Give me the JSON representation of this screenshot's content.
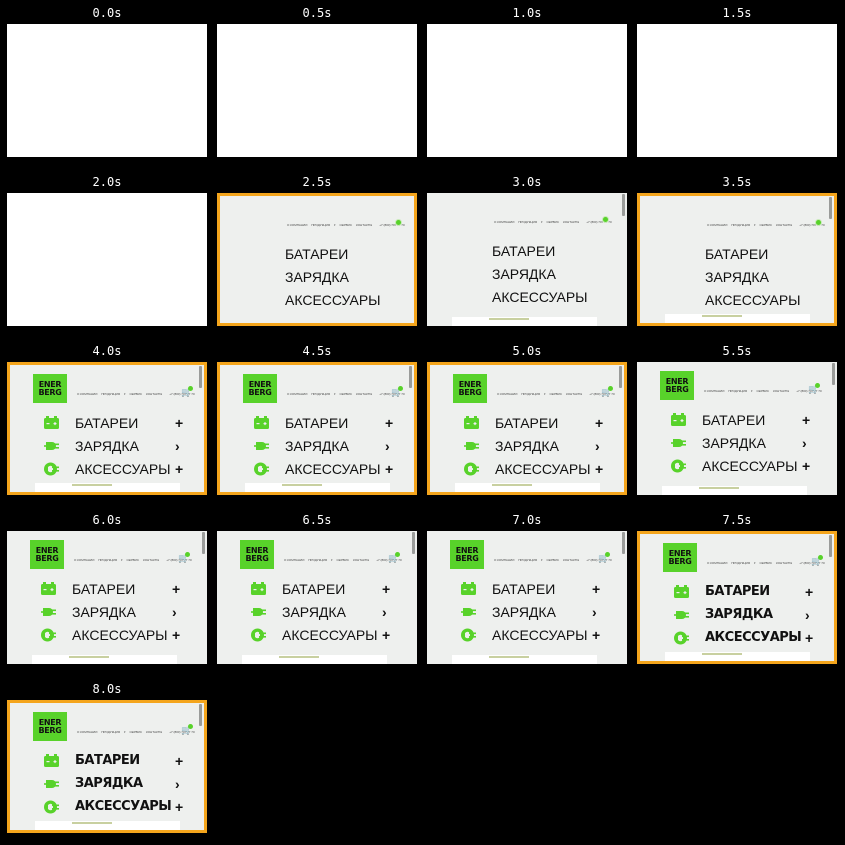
{
  "timestamps": [
    "0.0s",
    "0.5s",
    "1.0s",
    "1.5s",
    "2.0s",
    "2.5s",
    "3.0s",
    "3.5s",
    "4.0s",
    "4.5s",
    "5.0s",
    "5.5s",
    "6.0s",
    "6.5s",
    "7.0s",
    "7.5s",
    "8.0s"
  ],
  "site": {
    "logo_line1": "ENER",
    "logo_line2": "BERG",
    "nav": [
      "О КОМПАНИИ",
      "ПРОДУКЦИЯ",
      "СЕРВИС",
      "КОНТАКТЫ"
    ],
    "phone": "+7 (800) 707 77 70",
    "menu": [
      {
        "label": "БАТАРЕИ",
        "action": "+",
        "icon": "battery-icon"
      },
      {
        "label": "ЗАРЯДКА",
        "action": "›",
        "icon": "plug-icon"
      },
      {
        "label": "АКСЕССУАРЫ",
        "action": "+",
        "icon": "accessory-icon"
      }
    ]
  },
  "colors": {
    "background": "#000000",
    "highlight_border": "#f4a51c",
    "brand_green": "#58d22a",
    "site_bg": "#eef0ee"
  }
}
